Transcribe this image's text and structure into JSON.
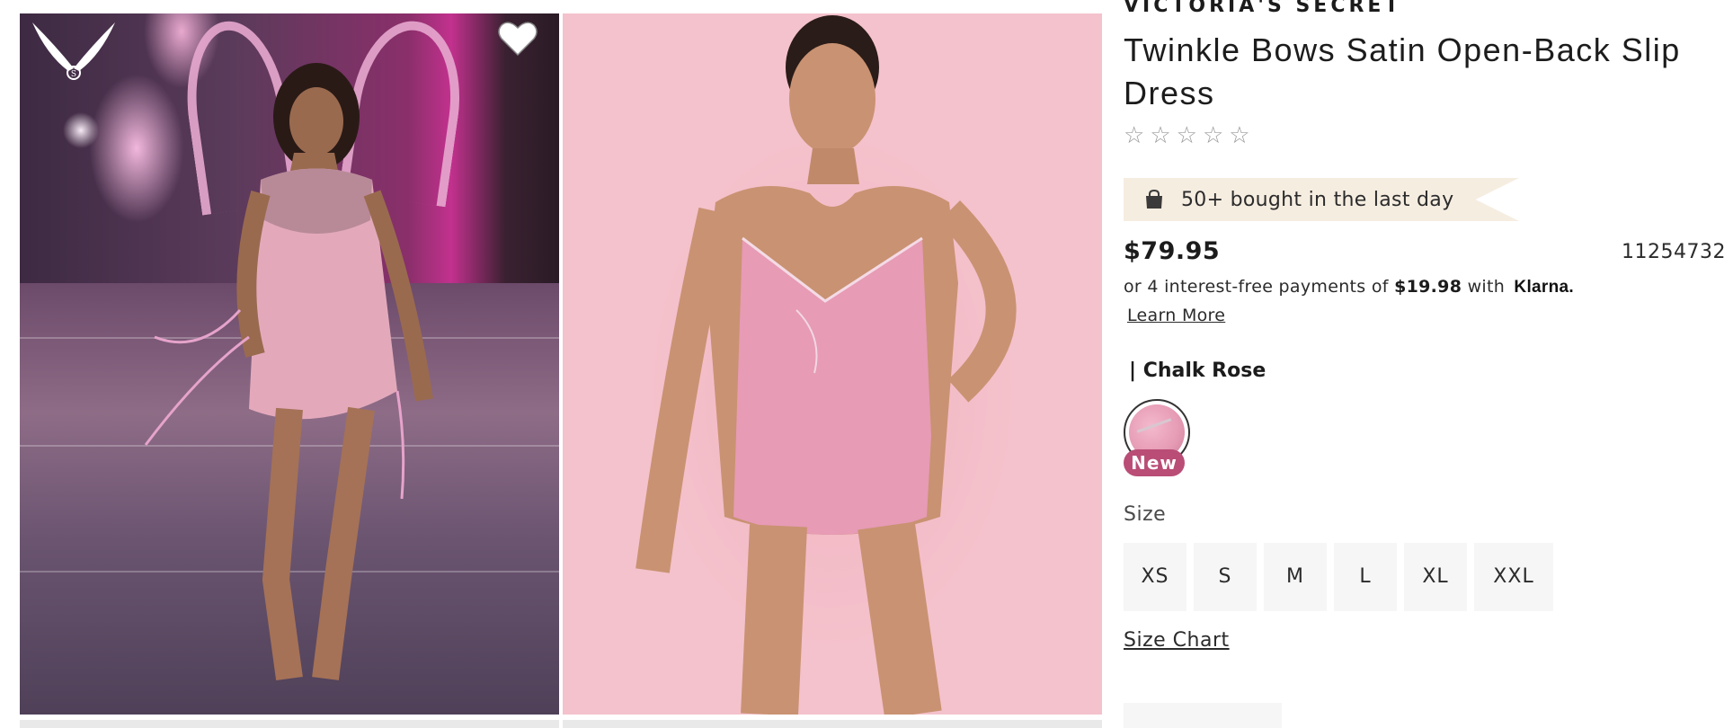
{
  "product": {
    "brand": "VICTORIA'S SECRET",
    "title": "Twinkle Bows Satin Open-Back Slip Dress",
    "rating": {
      "stars": 5,
      "filled": 0
    },
    "social_proof": "50+ bought in the last day",
    "price": "$79.95",
    "sku": "11254732",
    "klarna": {
      "prefix": "or 4 interest-free payments of",
      "amount": "$19.98",
      "middle": "with",
      "logo_text": "Klarna.",
      "learn_more": "Learn More"
    },
    "color": {
      "label": "| Chalk Rose",
      "badge": "New"
    },
    "size": {
      "label": "Size",
      "options": [
        "XS",
        "S",
        "M",
        "L",
        "XL",
        "XXL"
      ],
      "chart_link": "Size Chart"
    }
  },
  "icons": {
    "logo": "angel-wings-logo-icon",
    "favorite": "heart-icon",
    "bag": "shopping-bag-icon",
    "star": "star-outline-icon"
  },
  "colors": {
    "badge_bg": "#f6ede1",
    "new_badge": "#b94d76",
    "size_button_bg": "#f6f6f6",
    "photo_backdrop": "#f4c2cc"
  }
}
